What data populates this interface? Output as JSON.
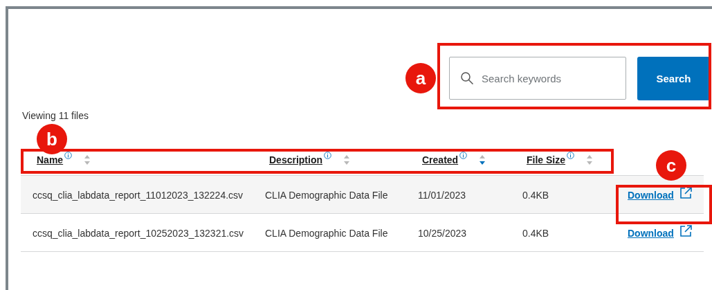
{
  "search": {
    "placeholder": "Search keywords",
    "button": "Search",
    "callout": "a"
  },
  "summary": "Viewing 11 files",
  "table": {
    "callout": "b",
    "columns": [
      {
        "label": "Name",
        "sorted": false
      },
      {
        "label": "Description",
        "sorted": false
      },
      {
        "label": "Created",
        "sorted": true
      },
      {
        "label": "File Size",
        "sorted": false
      }
    ],
    "rows": [
      {
        "name": "ccsq_clia_labdata_report_11012023_132224.csv",
        "description": "CLIA Demographic Data File",
        "created": "11/01/2023",
        "size": "0.4KB",
        "action": "Download",
        "callout": "c"
      },
      {
        "name": "ccsq_clia_labdata_report_10252023_132321.csv",
        "description": "CLIA Demographic Data File",
        "created": "10/25/2023",
        "size": "0.4KB",
        "action": "Download"
      }
    ]
  }
}
